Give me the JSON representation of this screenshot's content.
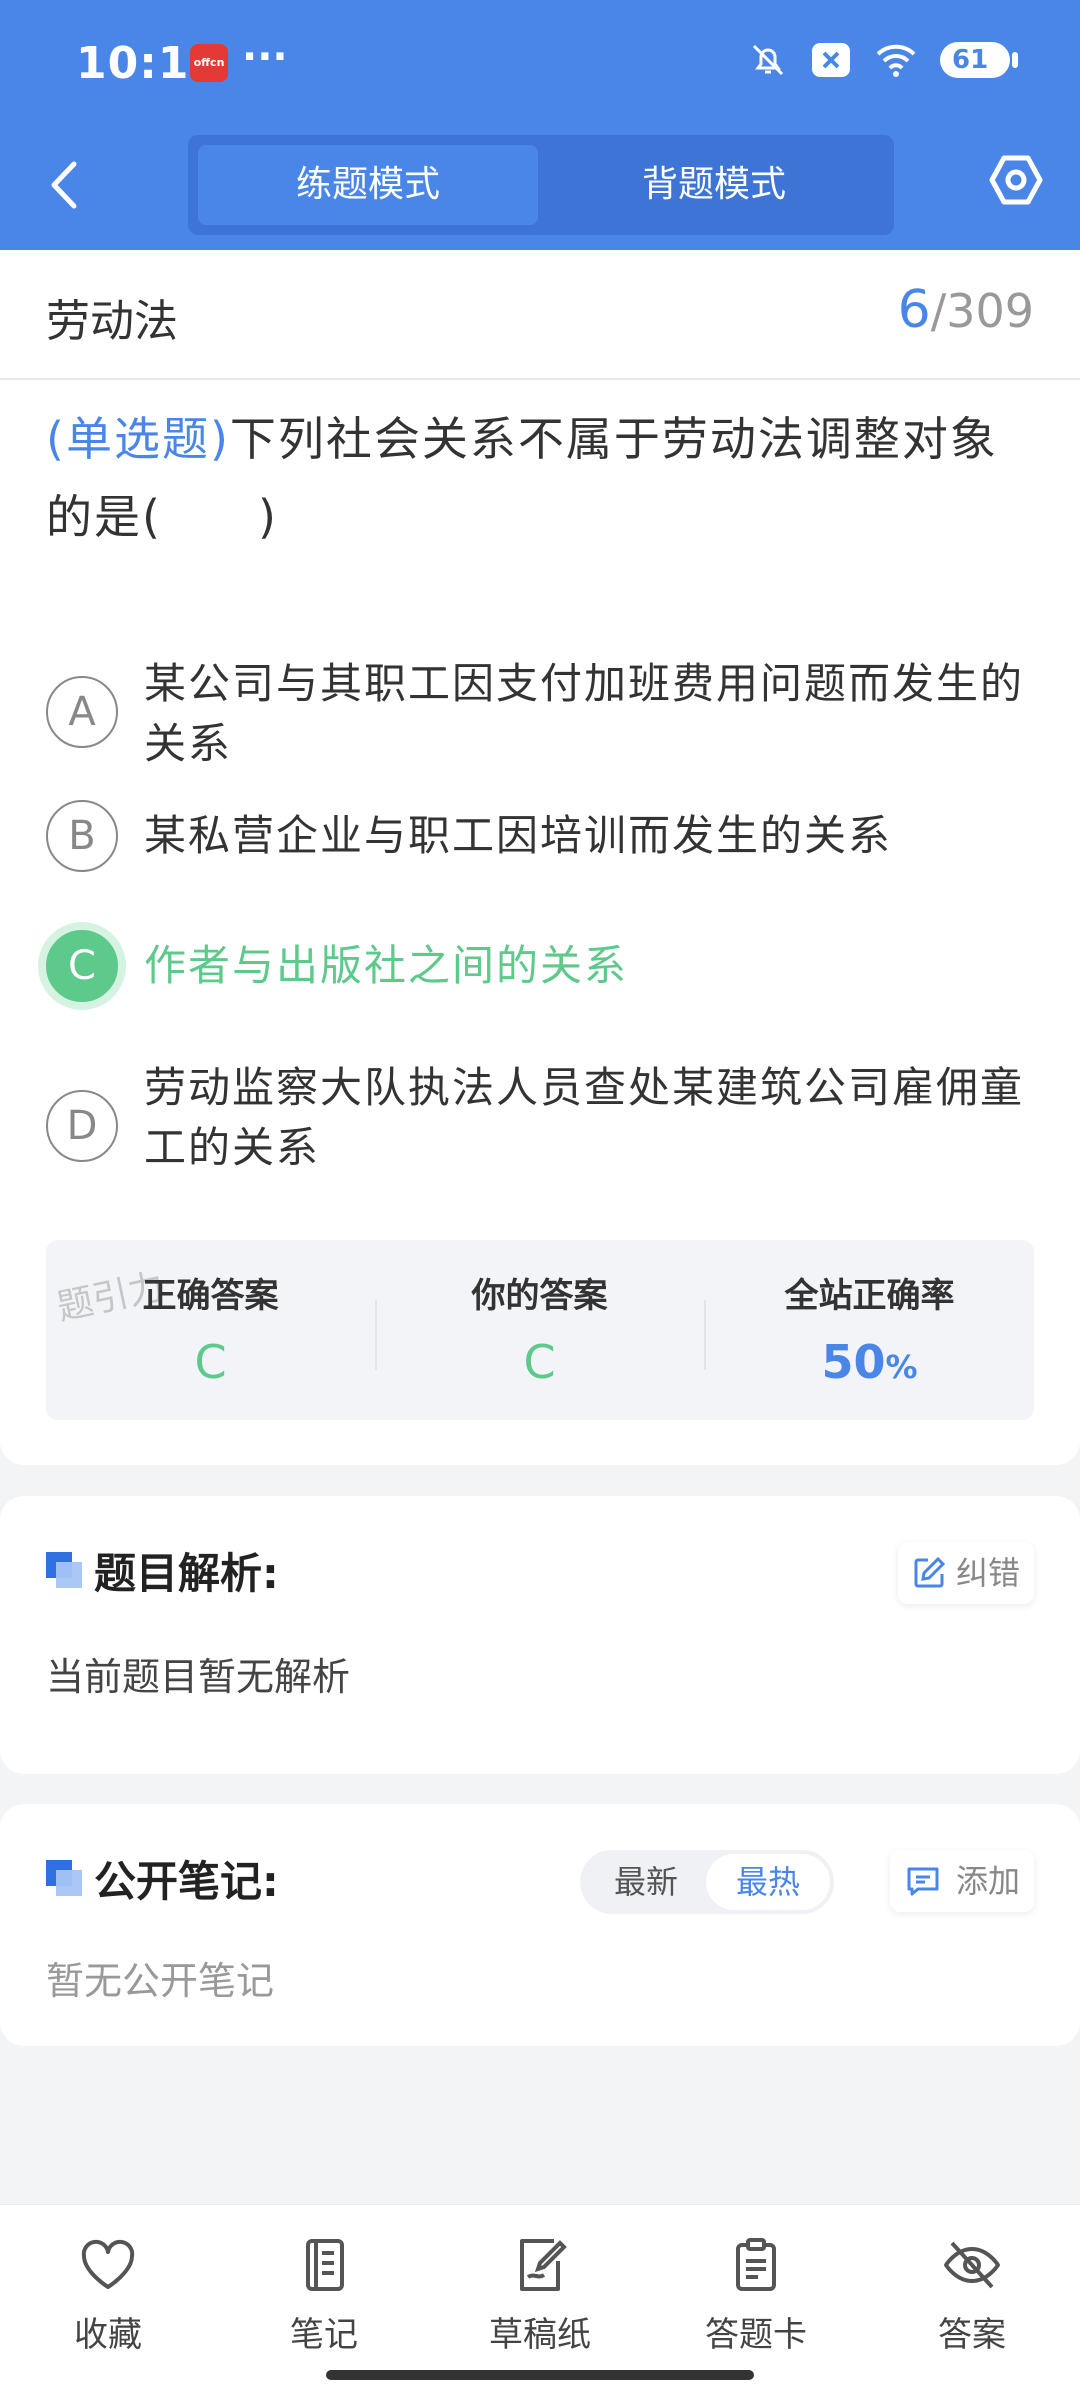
{
  "status_bar": {
    "time": "10:16",
    "app_badge": "offcn",
    "more": "···",
    "battery": "61"
  },
  "header": {
    "mode_practice": "练题模式",
    "mode_memorize": "背题模式"
  },
  "question": {
    "chapter": "劳动法",
    "current": "6",
    "separator": "/",
    "total": "309",
    "type_label": "(单选题)",
    "text": "下列社会关系不属于劳动法调整对象的是(　　)",
    "options": [
      {
        "letter": "A",
        "text": "某公司与其职工因支付加班费用问题而发生的关系"
      },
      {
        "letter": "B",
        "text": "某私营企业与职工因培训而发生的关系"
      },
      {
        "letter": "C",
        "text": "作者与出版社之间的关系"
      },
      {
        "letter": "D",
        "text": "劳动监察大队执法人员查处某建筑公司雇佣童工的关系"
      }
    ]
  },
  "stats": {
    "watermark": "题引力",
    "correct_label": "正确答案",
    "correct_value": "C",
    "yours_label": "你的答案",
    "yours_value": "C",
    "rate_label": "全站正确率",
    "rate_value": "50",
    "rate_unit": "%"
  },
  "analysis": {
    "title": "题目解析:",
    "report_label": "纠错",
    "body": "当前题目暂无解析"
  },
  "notes": {
    "title": "公开笔记:",
    "sort_latest": "最新",
    "sort_hot": "最热",
    "add_label": "添加",
    "empty": "暂无公开笔记"
  },
  "bottom_nav": {
    "favorite": "收藏",
    "notes": "笔记",
    "scratch": "草稿纸",
    "answer_card": "答题卡",
    "answer": "答案"
  },
  "colors": {
    "primary": "#4a86e8",
    "correct": "#5dc98a"
  }
}
